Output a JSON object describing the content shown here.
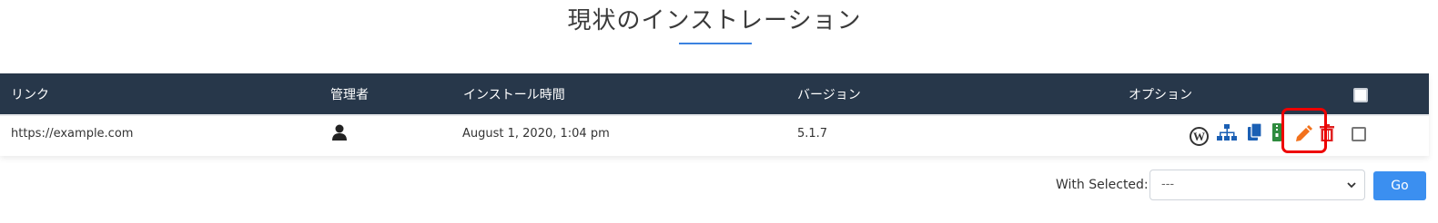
{
  "page": {
    "title": "現状のインストレーション"
  },
  "colors": {
    "header_bg": "#27374a",
    "accent": "#3b82e0",
    "edit_orange": "#f2711c",
    "delete_red": "#e02020",
    "highlight_red": "#ee0000",
    "go_button": "#3b8ff0"
  },
  "table": {
    "headers": {
      "link": "リンク",
      "admin": "管理者",
      "install_time": "インストール時間",
      "version": "バージョン",
      "options": "オプション"
    },
    "rows": [
      {
        "link": "https://example.com",
        "admin_icon": "user-icon",
        "install_time": "August 1, 2020, 1:04 pm",
        "version": "5.1.7",
        "option_icons": [
          "wordpress-icon",
          "sitemap-icon",
          "copy-icon",
          "archive-icon",
          "pencil-icon",
          "trash-icon"
        ]
      }
    ]
  },
  "bulk_actions": {
    "label": "With Selected:",
    "selected_option": "---",
    "go_label": "Go"
  }
}
